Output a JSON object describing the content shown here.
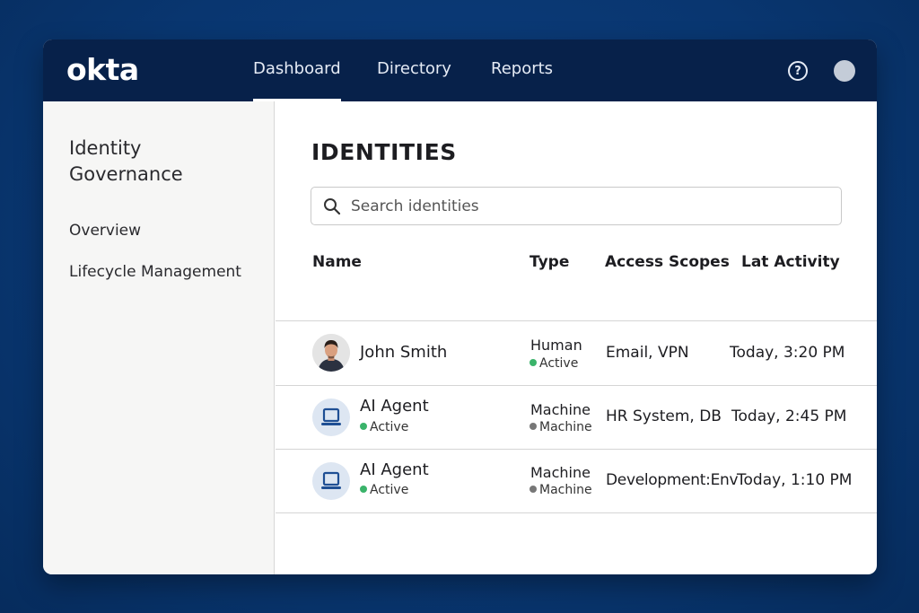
{
  "app": {
    "logo": "okta"
  },
  "nav": {
    "tabs": [
      {
        "label": "Dashboard",
        "active": true
      },
      {
        "label": "Directory"
      },
      {
        "label": "Reports"
      }
    ]
  },
  "header": {
    "help_icon": "help-circle-icon",
    "help_glyph": "?"
  },
  "sidebar": {
    "title": "Identity Governance",
    "items": [
      {
        "label": "Overview"
      },
      {
        "label": "Lifecycle Management"
      }
    ]
  },
  "main": {
    "title": "IDENTITIES",
    "search": {
      "placeholder": "Search identities",
      "value": ""
    },
    "columns": [
      "Name",
      "Type",
      "Access Scopes",
      "Lat Activity"
    ],
    "rows": [
      {
        "name": "John Smith",
        "avatar": "person-avatar",
        "type": "Human",
        "type_status": "Active",
        "type_status_color": "#3ab36a",
        "scopes": "Email, VPN",
        "activity": "Today, 3:20 PM"
      },
      {
        "name": "AI Agent",
        "name_status": "Active",
        "name_status_color": "#3ab36a",
        "avatar": "laptop-icon",
        "type": "Machine",
        "type_status": "Machine",
        "type_status_color": "#777777",
        "scopes": "HR System, DB",
        "activity": "Today, 2:45 PM"
      },
      {
        "name": "AI Agent",
        "name_status": "Active",
        "name_status_color": "#3ab36a",
        "avatar": "laptop-icon",
        "type": "Machine",
        "type_status": "Machine",
        "type_status_color": "#777777",
        "scopes": "Development:Env",
        "activity": "Today, 1:10 PM"
      }
    ]
  },
  "colors": {
    "topbar": "#07214a",
    "background": "#093670",
    "accent": "#1f5ca8",
    "active_dot": "#3ab36a",
    "machine_dot": "#777777"
  }
}
